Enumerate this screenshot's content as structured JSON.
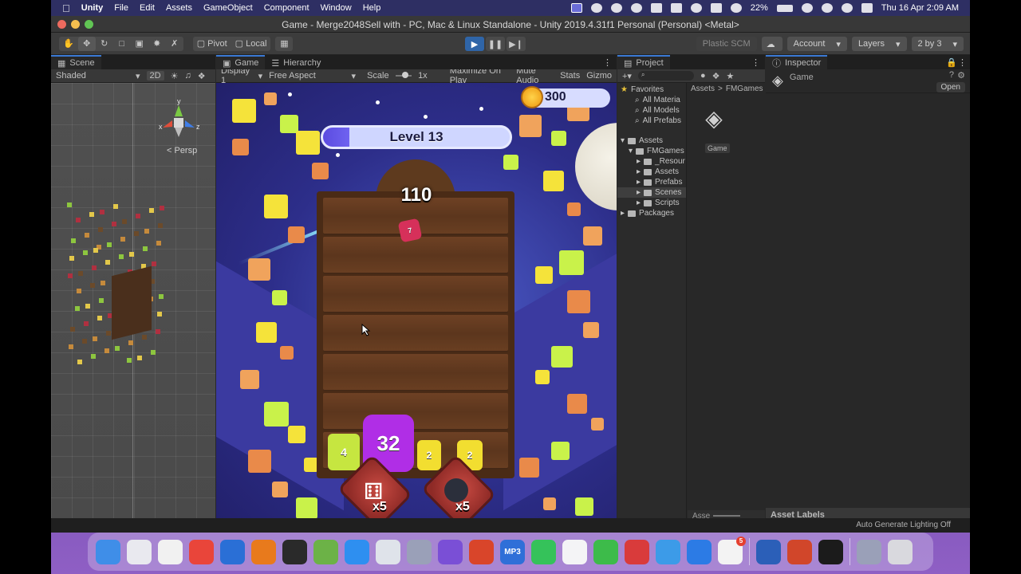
{
  "menubar": {
    "app_name": "Unity",
    "items": [
      "File",
      "Edit",
      "Assets",
      "GameObject",
      "Component",
      "Window",
      "Help"
    ],
    "battery": "22%",
    "datetime": "Thu 16 Apr  2:09 AM"
  },
  "window": {
    "title": "Game - Merge2048Sell with - PC, Mac & Linux Standalone - Unity 2019.4.31f1 Personal (Personal) <Metal>"
  },
  "toolbar": {
    "pivot_label": "Pivot",
    "local_label": "Local",
    "plastic_label": "Plastic SCM",
    "account_label": "Account",
    "layers_label": "Layers",
    "layout_label": "2 by 3"
  },
  "scene": {
    "tab_label": "Scene",
    "shading_mode": "Shaded",
    "mode_2d": "2D",
    "persp_label": "< Persp"
  },
  "game": {
    "tab_label": "Game",
    "hierarchy_tab_label": "Hierarchy",
    "display": "Display 1",
    "aspect": "Free Aspect",
    "scale_label": "Scale",
    "scale_value": "1x",
    "maximize_label": "Maximize On Play",
    "mute_label": "Mute Audio",
    "stats_label": "Stats",
    "gizmos_label": "Gizmo",
    "coins": "300",
    "level_text": "Level 13",
    "level_progress": 0.14,
    "score": "110",
    "falling_tile": "7",
    "tiles": [
      {
        "value": "4",
        "color": "#c6e640"
      },
      {
        "value": "32",
        "color": "#b02ee6"
      },
      {
        "value": "2",
        "color": "#f2de30"
      },
      {
        "value": "2",
        "color": "#f2de30"
      }
    ],
    "boosters": [
      {
        "name": "dice",
        "count": "x5"
      },
      {
        "name": "bomb",
        "count": "x5"
      }
    ]
  },
  "project": {
    "tab_label": "Project",
    "favorites_label": "Favorites",
    "favorites": [
      "All Materia",
      "All Models",
      "All Prefabs"
    ],
    "assets_label": "Assets",
    "fmgames_label": "FMGames",
    "subfolders": [
      "_Resour",
      "Assets",
      "Prefabs",
      "Scenes",
      "Scripts"
    ],
    "packages_label": "Packages",
    "breadcrumb": [
      "Assets",
      ">",
      "FMGames"
    ],
    "selected_asset": "Game",
    "footer_label": "Asse"
  },
  "inspector": {
    "tab_label": "Inspector",
    "object_name": "Game",
    "open_label": "Open",
    "asset_labels": "Asset Labels"
  },
  "status": {
    "text": "Auto Generate Lighting Off"
  },
  "dock": {
    "apps": [
      {
        "name": "finder",
        "color": "#3f8ee8"
      },
      {
        "name": "launchpad",
        "color": "#e9e9ef"
      },
      {
        "name": "chrome",
        "color": "#f1f1f1"
      },
      {
        "name": "anydesk",
        "color": "#e9453a"
      },
      {
        "name": "sourcetree",
        "color": "#2a6fd6"
      },
      {
        "name": "blender",
        "color": "#e87a1c"
      },
      {
        "name": "activity-monitor",
        "color": "#2a2a2a"
      },
      {
        "name": "android-studio",
        "color": "#6cb247"
      },
      {
        "name": "safari",
        "color": "#2e8ff0"
      },
      {
        "name": "unity-hub",
        "color": "#dfe3ea"
      },
      {
        "name": "help",
        "color": "#9aa0b8"
      },
      {
        "name": "visual-studio",
        "color": "#7a4fd6"
      },
      {
        "name": "remote",
        "color": "#d9452a"
      },
      {
        "name": "mp3",
        "color": "#2f6fd8"
      },
      {
        "name": "whatsapp",
        "color": "#35c25a"
      },
      {
        "name": "freeform",
        "color": "#f4f4f6"
      },
      {
        "name": "clipboard",
        "color": "#3dbb4a"
      },
      {
        "name": "powerpoint-p",
        "color": "#d93b3b"
      },
      {
        "name": "facetime",
        "color": "#3c9be8"
      },
      {
        "name": "pdf",
        "color": "#2c7be5"
      },
      {
        "name": "store",
        "color": "#f3f3f3"
      },
      {
        "name": "word",
        "color": "#2b5fb8"
      },
      {
        "name": "powerpoint",
        "color": "#d1462a"
      },
      {
        "name": "unity",
        "color": "#1b1b1b"
      },
      {
        "name": "help-2",
        "color": "#9aa0b8"
      },
      {
        "name": "trash",
        "color": "#d9d9de"
      }
    ],
    "store_badge": "5",
    "mp3_label": "MP3"
  }
}
